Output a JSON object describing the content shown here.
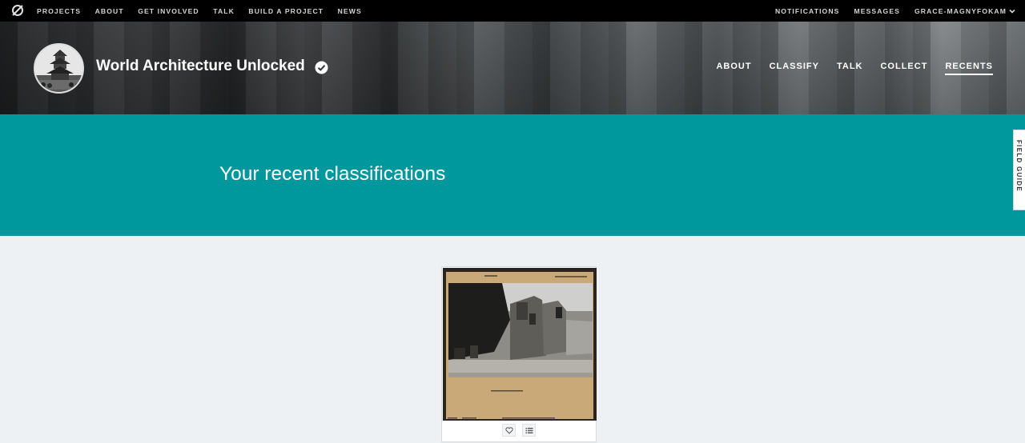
{
  "topnav": {
    "logo_icon": "zooniverse-logo-icon",
    "left_items": [
      "PROJECTS",
      "ABOUT",
      "GET INVOLVED",
      "TALK",
      "BUILD A PROJECT",
      "NEWS"
    ],
    "right_items": [
      "NOTIFICATIONS",
      "MESSAGES"
    ],
    "user_label": "GRACE-MAGNYFOKAM"
  },
  "project": {
    "title": "World Architecture Unlocked",
    "verified_icon": "verified-check-icon",
    "nav": [
      "ABOUT",
      "CLASSIFY",
      "TALK",
      "COLLECT",
      "RECENTS"
    ],
    "active_nav": "RECENTS"
  },
  "banner": {
    "heading": "Your recent classifications",
    "field_guide_label": "FIELD GUIDE"
  },
  "recents": {
    "items": [
      {
        "thumbnail": "archival-photo-of-fort-wall",
        "favorite_icon": "heart-icon",
        "collect_icon": "list-icon"
      }
    ]
  },
  "colors": {
    "topnav_bg": "#000000",
    "banner_bg": "#00979d",
    "page_bg": "#eef1f4"
  }
}
